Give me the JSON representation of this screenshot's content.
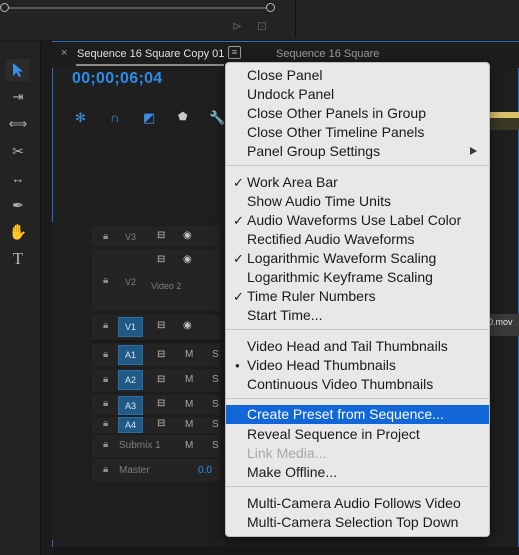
{
  "tab": {
    "active_label": "Sequence 16 Square Copy 01",
    "inactive_label": "Sequence 16 Square",
    "close_glyph": "×",
    "menu_glyph": "≡"
  },
  "timecode": "00;00;06;04",
  "tracks": {
    "v3": "V3",
    "v2": "V2",
    "v2_name": "Video 2",
    "v1": "V1",
    "a1": "A1",
    "a2": "A2",
    "a3": "A3",
    "a4": "A4",
    "submix": "Submix 1",
    "master": "Master",
    "master_value": "0.0",
    "mute": "M",
    "solo": "S"
  },
  "clip_label": "0.mov",
  "menu": {
    "items": [
      {
        "label": "Close Panel"
      },
      {
        "label": "Undock Panel"
      },
      {
        "label": "Close Other Panels in Group"
      },
      {
        "label": "Close Other Timeline Panels"
      },
      {
        "label": "Panel Group Settings",
        "submenu": true
      },
      {
        "label": "Work Area Bar",
        "checked": true
      },
      {
        "label": "Show Audio Time Units"
      },
      {
        "label": "Audio Waveforms Use Label Color",
        "checked": true
      },
      {
        "label": "Rectified Audio Waveforms"
      },
      {
        "label": "Logarithmic Waveform Scaling",
        "checked": true
      },
      {
        "label": "Logarithmic Keyframe Scaling"
      },
      {
        "label": "Time Ruler Numbers",
        "checked": true
      },
      {
        "label": "Start Time..."
      },
      {
        "label": "Video Head and Tail Thumbnails"
      },
      {
        "label": "Video Head Thumbnails",
        "radio": true
      },
      {
        "label": "Continuous Video Thumbnails"
      },
      {
        "label": "Create Preset from Sequence...",
        "highlighted": true
      },
      {
        "label": "Reveal Sequence in Project"
      },
      {
        "label": "Link Media...",
        "disabled": true
      },
      {
        "label": "Make Offline..."
      },
      {
        "label": "Multi-Camera Audio Follows Video"
      },
      {
        "label": "Multi-Camera Selection Top Down"
      }
    ],
    "check_glyph": "✓",
    "radio_glyph": "●"
  },
  "colors": {
    "accent_blue": "#2d8ceb",
    "menu_highlight": "#1167d8",
    "track_target_blue": "#1f5a86"
  },
  "icons": {
    "tools": [
      "selection-tool-icon",
      "track-select-tool-icon",
      "ripple-edit-tool-icon",
      "razor-tool-icon",
      "slip-tool-icon",
      "pen-tool-icon",
      "hand-tool-icon",
      "type-tool-icon"
    ],
    "timeline": [
      "snap-icon",
      "linked-selection-icon",
      "add-marker-icon",
      "settings-wrench-icon"
    ]
  }
}
